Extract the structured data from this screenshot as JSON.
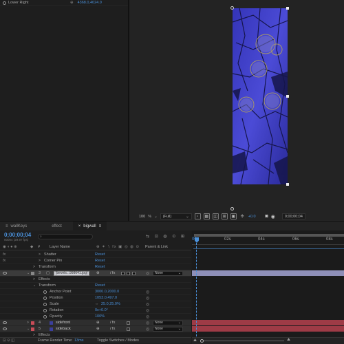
{
  "effect_controls": {
    "rows": [
      {
        "label": "Lower Right",
        "value": "4368.0,4024.0"
      }
    ]
  },
  "viewer": {
    "zoom": "100",
    "zoom_unit": "%",
    "resolution": "(Full)",
    "exposure": "+0.0",
    "timecode": "0;00;00;04"
  },
  "tabs": [
    {
      "label": "wallKeys",
      "active": false
    },
    {
      "label": "effect",
      "active": false
    },
    {
      "label": "bigwall",
      "active": true
    }
  ],
  "timeline": {
    "current_time": "0;00;00;04",
    "frame_info": "00004 (29.97 fps)",
    "search_placeholder": "",
    "col_hash": "#",
    "col_layer_name": "Layer Name",
    "col_parent": "Parent & Link",
    "rulers": [
      "00s",
      "02s",
      "04s",
      "06s",
      "08s"
    ],
    "rows": [
      {
        "type": "effect",
        "fx": "fx",
        "name": "Shatter",
        "value": "Reset"
      },
      {
        "type": "effect",
        "fx": "fx",
        "name": "Corner Pin",
        "value": "Reset"
      },
      {
        "type": "group",
        "name": "Transform",
        "value": "Reset"
      },
      {
        "type": "layer",
        "num": "3",
        "name": "[bevels...998641.jpg]",
        "parent": "None"
      },
      {
        "type": "group",
        "name": "Effects"
      },
      {
        "type": "group",
        "name": "Transform",
        "value": "Reset"
      },
      {
        "type": "prop",
        "name": "Anchor Point",
        "value": "3000.0,2000.0"
      },
      {
        "type": "prop",
        "name": "Position",
        "value": "1053.0,497.0"
      },
      {
        "type": "prop",
        "name": "Scale",
        "value": "25.0,25.0%"
      },
      {
        "type": "prop",
        "name": "Rotation",
        "value": "0x+0.0°"
      },
      {
        "type": "prop",
        "name": "Opacity",
        "value": "100%"
      },
      {
        "type": "layer",
        "num": "4",
        "name": "sidefront",
        "parent": "None",
        "color": "#3b3f9c"
      },
      {
        "type": "layer",
        "num": "5",
        "name": "sideback",
        "parent": "None",
        "color": "#3b3f9c"
      },
      {
        "type": "group",
        "name": "Effects"
      }
    ],
    "footer_render_label": "Frame Render Time:",
    "footer_render_value": "13ms",
    "footer_toggle": "Toggle Switches / Modes"
  },
  "colors": {
    "accent": "#4a90d9",
    "layer3_bar": "#8e8fb8",
    "layer45_bar": "#9e3b46",
    "layer_label_red": "#c94c58"
  }
}
